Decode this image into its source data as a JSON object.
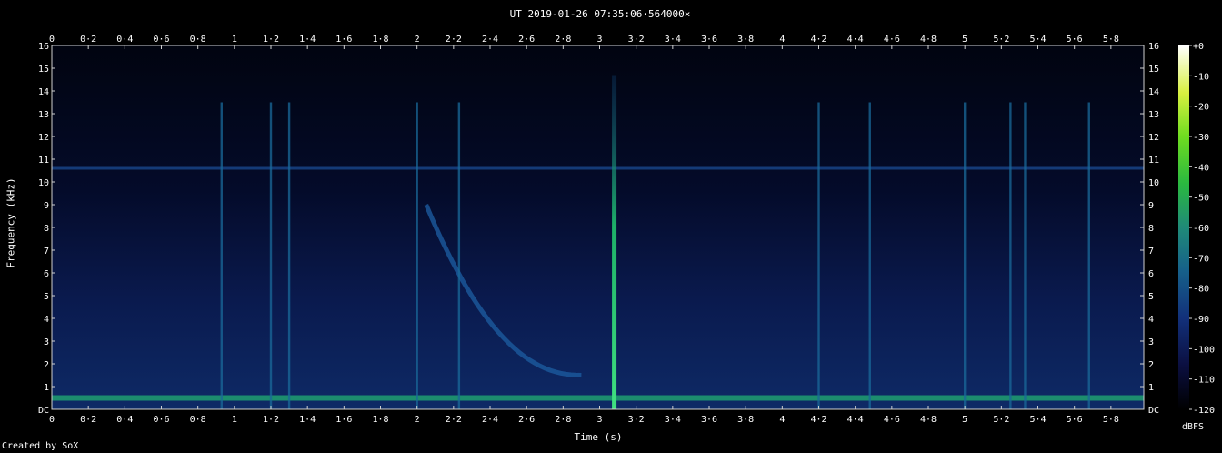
{
  "chart_data": {
    "type": "heatmap",
    "title": "UT 2019-01-26 07:35:06·564000×",
    "xlabel": "Time (s)",
    "ylabel": "Frequency (kHz)",
    "xlim": [
      0,
      5.98
    ],
    "ylim": [
      0,
      16
    ],
    "x_ticks": [
      "0",
      "0·2",
      "0·4",
      "0·6",
      "0·8",
      "1",
      "1·2",
      "1·4",
      "1·6",
      "1·8",
      "2",
      "2·2",
      "2·4",
      "2·6",
      "2·8",
      "3",
      "3·2",
      "3·4",
      "3·6",
      "3·8",
      "4",
      "4·2",
      "4·4",
      "4·6",
      "4·8",
      "5",
      "5·2",
      "5·4",
      "5·6",
      "5·8"
    ],
    "y_ticks": [
      "DC",
      "1",
      "2",
      "3",
      "4",
      "5",
      "6",
      "7",
      "8",
      "9",
      "10",
      "11",
      "12",
      "13",
      "14",
      "15",
      "16"
    ],
    "colorbar": {
      "label": "dBFS",
      "range": [
        -120,
        0
      ],
      "ticks": [
        "+0",
        "-10",
        "-20",
        "-30",
        "-40",
        "-50",
        "-60",
        "-70",
        "-80",
        "-90",
        "-100",
        "-110",
        "-120"
      ]
    },
    "features": {
      "constant_tones_khz": [
        0.5,
        10.6
      ],
      "broadband_impulses_s": [
        0.93,
        1.2,
        1.3,
        2.0,
        2.23,
        3.08,
        4.2,
        4.48,
        5.0,
        5.25,
        5.33,
        5.68
      ],
      "dominant_impulse_s": 3.08,
      "falling_tone": {
        "start_s": 2.05,
        "start_khz": 9.0,
        "end_s": 2.9,
        "end_khz": 1.5
      }
    },
    "footer": "Created by SoX"
  }
}
